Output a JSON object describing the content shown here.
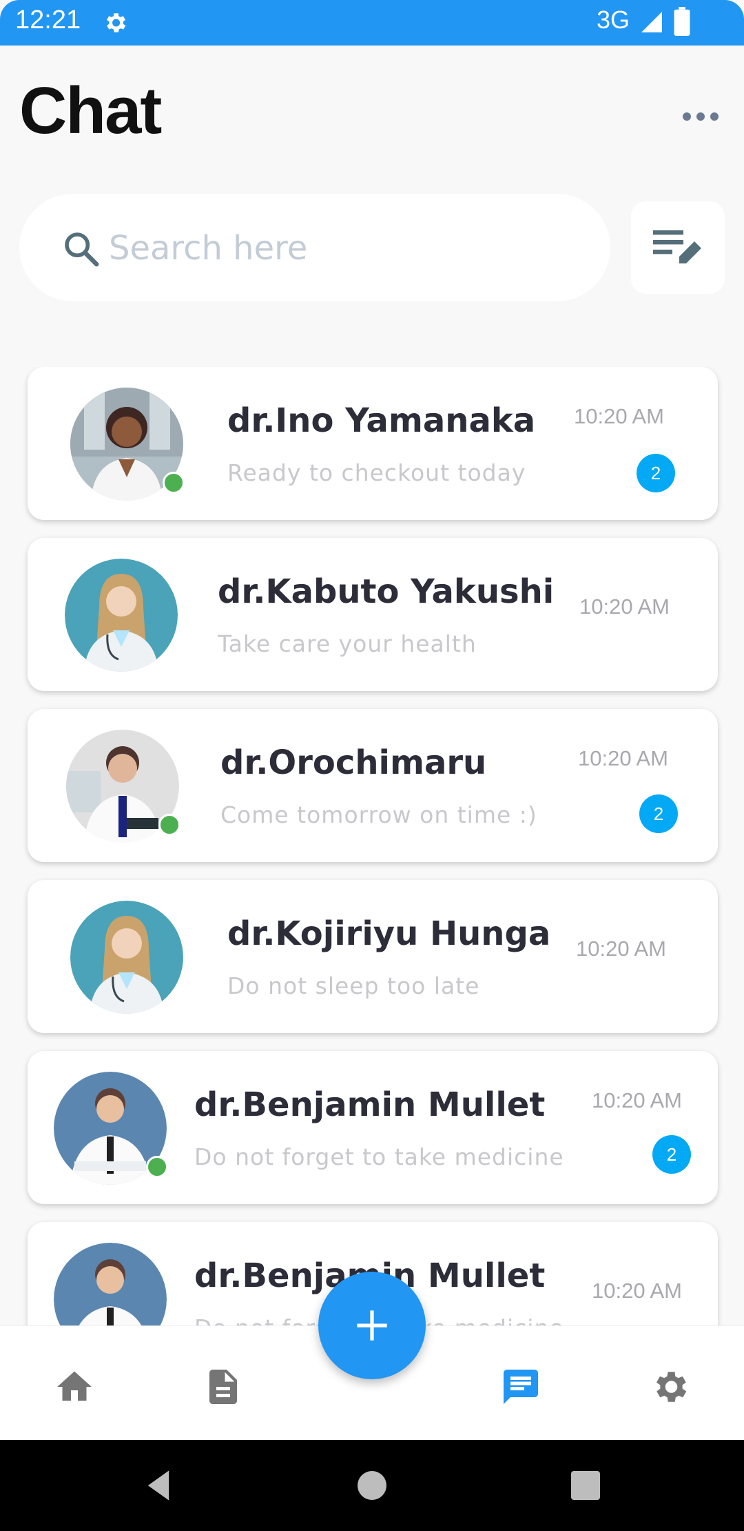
{
  "status_bar": {
    "time": "12:21",
    "network": "3G",
    "color": "#2196f3"
  },
  "header": {
    "title": "Chat"
  },
  "search": {
    "placeholder": "Search here"
  },
  "chats": [
    {
      "name": "dr.Ino Yamanaka",
      "preview": "Ready to checkout today",
      "time": "10:20 AM",
      "unread": "2",
      "online": true
    },
    {
      "name": "dr.Kabuto Yakushi",
      "preview": "Take care your health",
      "time": "10:20 AM",
      "unread": "",
      "online": false
    },
    {
      "name": "dr.Orochimaru",
      "preview": "Come tomorrow on time :)",
      "time": "10:20 AM",
      "unread": "2",
      "online": true
    },
    {
      "name": "dr.Kojiriyu Hunga",
      "preview": "Do not sleep too late",
      "time": "10:20 AM",
      "unread": "",
      "online": false
    },
    {
      "name": "dr.Benjamin Mullet",
      "preview": "Do not forget to take medicine",
      "time": "10:20 AM",
      "unread": "2",
      "online": true
    },
    {
      "name": "dr.Benjamin Mullet",
      "preview": "Do not forget to take medicine",
      "time": "10:20 AM",
      "unread": "",
      "online": false
    }
  ],
  "bottom_nav": {
    "items": [
      "home-icon",
      "document-icon",
      "chat-icon",
      "settings-icon"
    ],
    "active": "chat-icon",
    "active_color": "#2196f3",
    "inactive_color": "#757575"
  },
  "fab_icon": "plus-icon"
}
